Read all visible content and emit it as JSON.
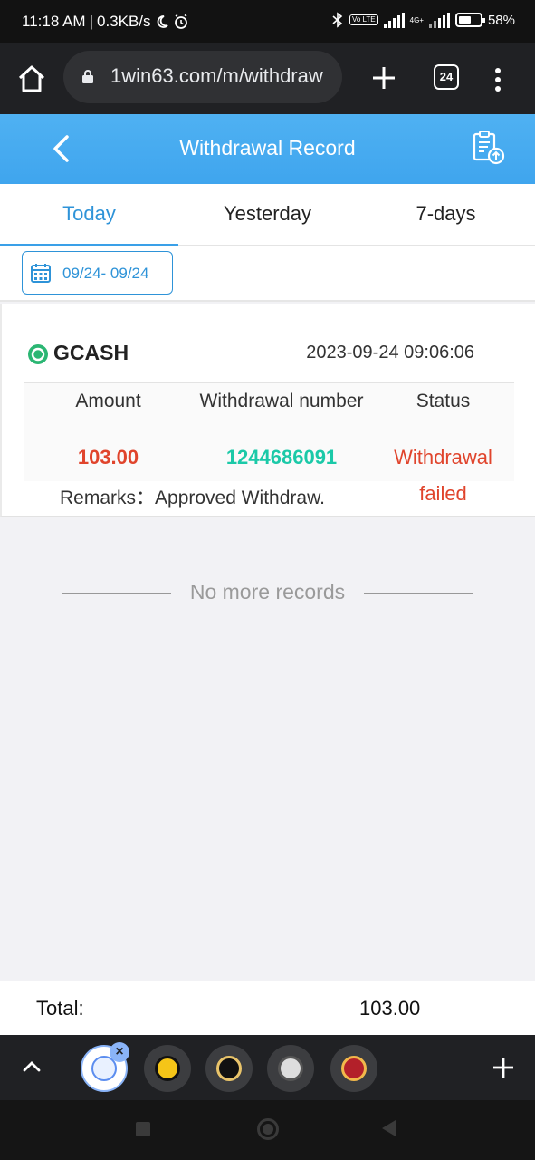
{
  "status_bar": {
    "time": "11:18 AM",
    "net_speed": "0.3KB/s",
    "volte_label": "Vo LTE",
    "network_label": "4G+",
    "battery_pct": "58%",
    "battery_level": 0.58
  },
  "browser": {
    "url": "1win63.com/m/withdraw",
    "tab_count": "24"
  },
  "header": {
    "title": "Withdrawal Record"
  },
  "tabs": [
    {
      "label": "Today",
      "active": true
    },
    {
      "label": "Yesterday",
      "active": false
    },
    {
      "label": "7-days",
      "active": false
    }
  ],
  "date_filter": {
    "label": "09/24- 09/24"
  },
  "record": {
    "method": "GCASH",
    "datetime": "2023-09-24 09:06:06",
    "headers": {
      "amount": "Amount",
      "number": "Withdrawal number",
      "status": "Status"
    },
    "amount": "103.00",
    "number": "1244686091",
    "status_line1": "Withdrawal",
    "status_line2": "failed",
    "remarks": "Remarks：Approved Withdraw."
  },
  "no_more": "No more records",
  "total": {
    "label": "Total:",
    "value": "103.00"
  },
  "colors": {
    "header_blue": "#3fa5ee",
    "tab_active": "#2e93d8",
    "amount_red": "#e0442c",
    "number_teal": "#1bc9a8",
    "gcash_green": "#2bb673"
  },
  "strip_icons": [
    "1win-tab-icon",
    "w-casino-tab-icon",
    "lock-tab-icon",
    "document-tab-icon",
    "casino-tab-icon"
  ]
}
